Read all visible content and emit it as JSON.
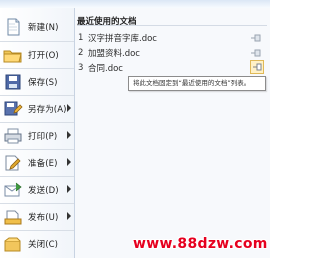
{
  "menu": {
    "items": [
      {
        "label": "新建(N)",
        "icon": "new-document-icon",
        "has_submenu": false
      },
      {
        "label": "打开(O)",
        "icon": "open-folder-icon",
        "has_submenu": false
      },
      {
        "label": "保存(S)",
        "icon": "save-floppy-icon",
        "has_submenu": false
      },
      {
        "label": "另存为(A)",
        "icon": "save-as-icon",
        "has_submenu": true
      },
      {
        "label": "打印(P)",
        "icon": "printer-icon",
        "has_submenu": true
      },
      {
        "label": "准备(E)",
        "icon": "prepare-document-icon",
        "has_submenu": true
      },
      {
        "label": "发送(D)",
        "icon": "send-icon",
        "has_submenu": true
      },
      {
        "label": "发布(U)",
        "icon": "publish-icon",
        "has_submenu": true
      },
      {
        "label": "关闭(C)",
        "icon": "close-document-icon",
        "has_submenu": false
      }
    ]
  },
  "recent": {
    "header": "最近使用的文档",
    "items": [
      {
        "number": "1",
        "name": "汉字拼音字库.doc",
        "pin_icon": "pin-icon",
        "pin_active": false
      },
      {
        "number": "2",
        "name": "加盟资料.doc",
        "pin_icon": "pin-icon",
        "pin_active": false
      },
      {
        "number": "3",
        "name": "合同.doc",
        "pin_icon": "pin-icon",
        "pin_active": true
      }
    ]
  },
  "tooltip": {
    "text": "将此文档固定到“最近使用的文档”列表。"
  },
  "watermark": {
    "text": "www.88dzw.com"
  },
  "colors": {
    "accent_blue": "#2d5f98",
    "active_pin_fill": "#fff1c6",
    "watermark_red": "#e6001f"
  }
}
